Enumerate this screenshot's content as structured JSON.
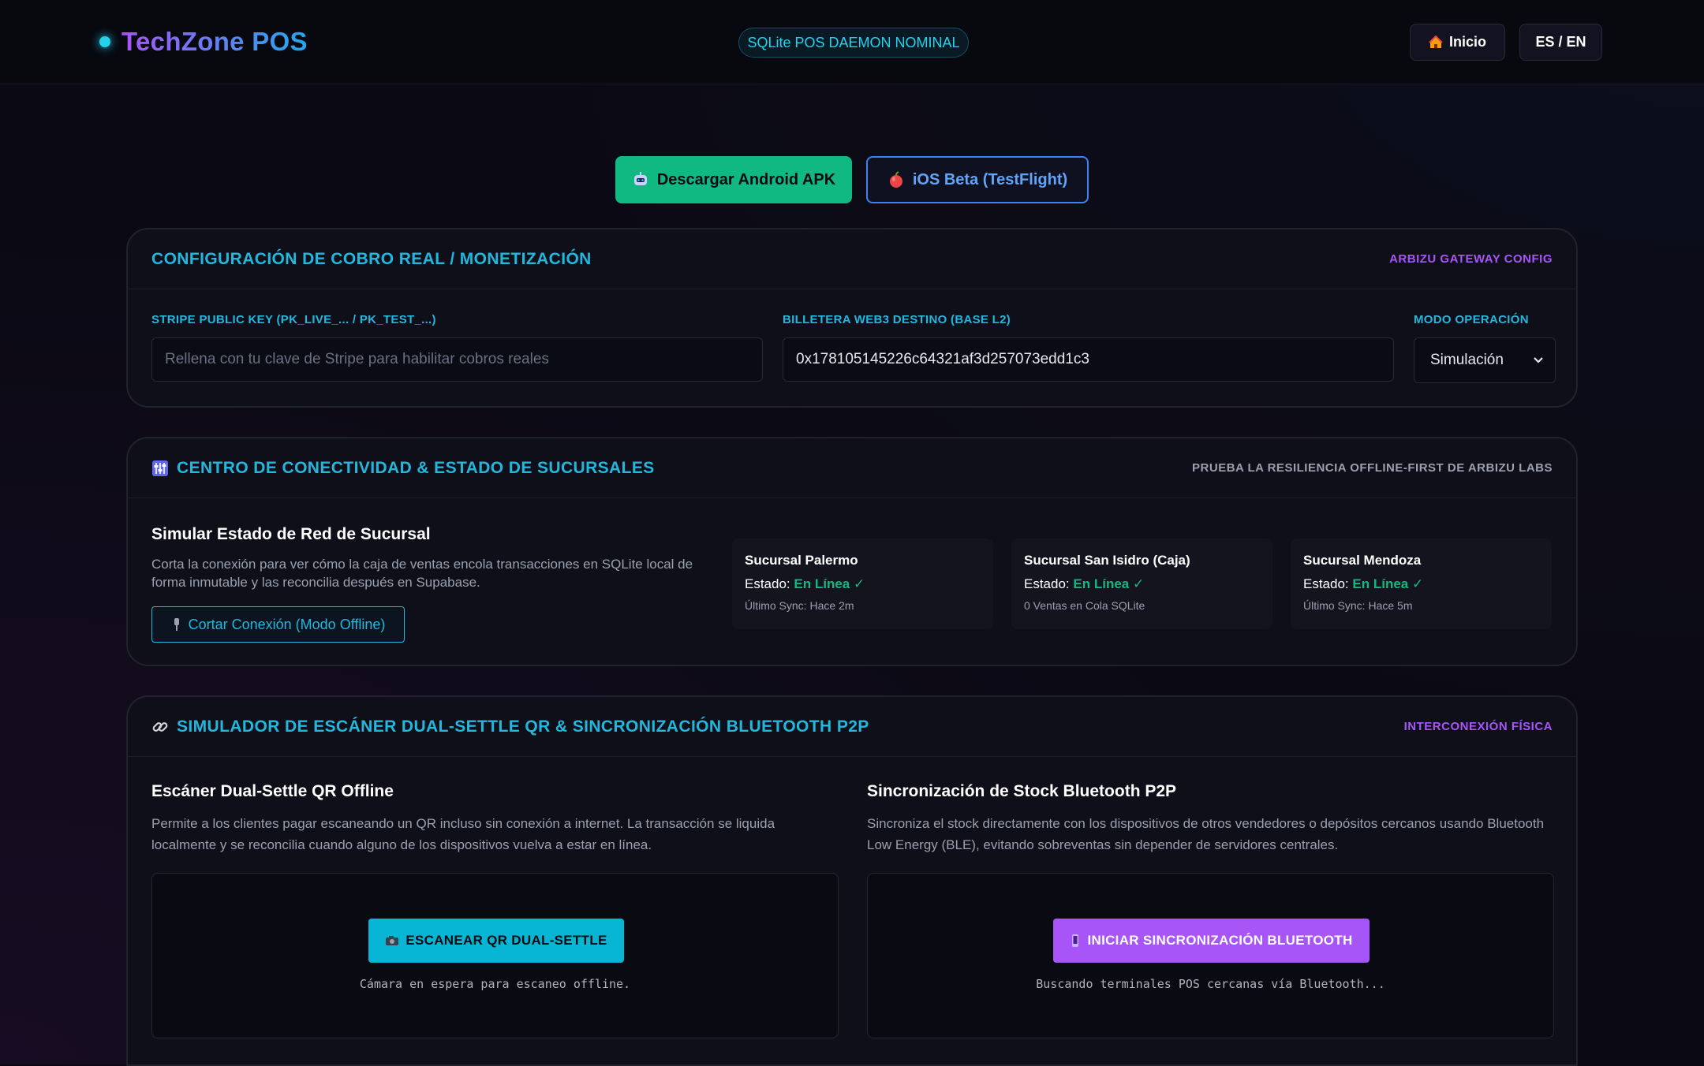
{
  "header": {
    "brand": "TechZone POS",
    "daemon_status": "SQLite POS DAEMON NOMINAL",
    "home_label": "Inicio",
    "lang_label": "ES / EN"
  },
  "downloads": {
    "android_label": "Descargar Android APK",
    "ios_label": "iOS Beta (TestFlight)"
  },
  "billing": {
    "title": "CONFIGURACIÓN DE COBRO REAL / MONETIZACIÓN",
    "tag": "ARBIZU GATEWAY CONFIG",
    "stripe_label": "STRIPE PUBLIC KEY (PK_LIVE_... / PK_TEST_...)",
    "stripe_placeholder": "Rellena con tu clave de Stripe para habilitar cobros reales",
    "wallet_label": "BILLETERA WEB3 DESTINO (BASE L2)",
    "wallet_value": "0x178105145226c64321af3d257073edd1c3",
    "mode_label": "MODO OPERACIÓN",
    "mode_value": "Simulación"
  },
  "connectivity": {
    "title": "CENTRO DE CONECTIVIDAD & ESTADO DE SUCURSALES",
    "tag": "PRUEBA LA RESILIENCIA OFFLINE-FIRST DE ARBIZU LABS",
    "sim_title": "Simular Estado de Red de Sucursal",
    "sim_desc": "Corta la conexión para ver cómo la caja de ventas encola transacciones en SQLite local de forma inmutable y las reconcilia después en Supabase.",
    "cut_label": "Cortar Conexión (Modo Offline)",
    "status_prefix": "Estado:",
    "branches": [
      {
        "name": "Sucursal Palermo",
        "status": "En Línea ✓",
        "meta": "Último Sync: Hace 2m"
      },
      {
        "name": "Sucursal San Isidro (Caja)",
        "status": "En Línea ✓",
        "meta": "0 Ventas en Cola SQLite"
      },
      {
        "name": "Sucursal Mendoza",
        "status": "En Línea ✓",
        "meta": "Último Sync: Hace 5m"
      }
    ]
  },
  "scanner": {
    "title": "SIMULADOR DE ESCÁNER DUAL-SETTLE QR & SINCRONIZACIÓN BLUETOOTH P2P",
    "tag": "INTERCONEXIÓN FÍSICA",
    "qr_title": "Escáner Dual-Settle QR Offline",
    "qr_desc": "Permite a los clientes pagar escaneando un QR incluso sin conexión a internet. La transacción se liquida localmente y se reconcilia cuando alguno de los dispositivos vuelva a estar en línea.",
    "qr_button": "ESCANEAR QR DUAL-SETTLE",
    "qr_note": "Cámara en espera para escaneo offline.",
    "bt_title": "Sincronización de Stock Bluetooth P2P",
    "bt_desc": "Sincroniza el stock directamente con los dispositivos de otros vendedores o depósitos cercanos usando Bluetooth Low Energy (BLE), evitando sobreventas sin depender de servidores centrales.",
    "bt_button": "INICIAR SINCRONIZACIÓN BLUETOOTH",
    "bt_note": "Buscando terminales POS cercanas vía Bluetooth..."
  },
  "colors": {
    "accent_cyan": "#22b8dd",
    "accent_purple": "#a855f7",
    "success_green": "#10b981",
    "ios_blue": "#3b82f6"
  },
  "icons": {
    "home": "house-icon",
    "android": "robot-icon",
    "ios": "apple-icon",
    "connectivity": "control-knobs-icon",
    "cut": "unplugged-icon",
    "scanner": "link-icon",
    "camera": "camera-icon",
    "bluetooth": "phone-signal-icon"
  }
}
